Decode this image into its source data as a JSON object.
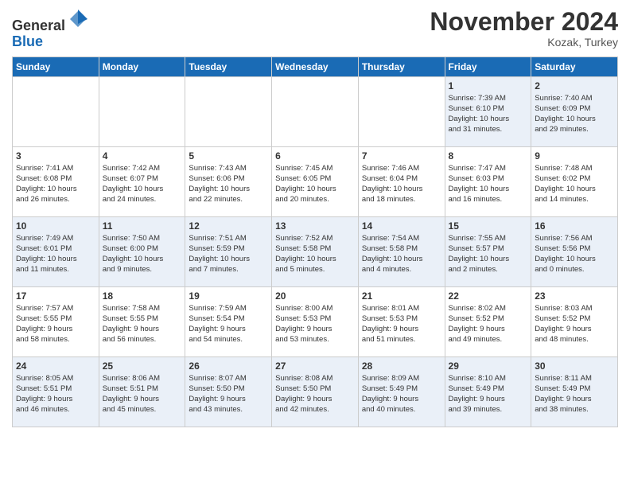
{
  "header": {
    "logo_line1": "General",
    "logo_line2": "Blue",
    "month": "November 2024",
    "location": "Kozak, Turkey"
  },
  "weekdays": [
    "Sunday",
    "Monday",
    "Tuesday",
    "Wednesday",
    "Thursday",
    "Friday",
    "Saturday"
  ],
  "weeks": [
    [
      {
        "day": "",
        "info": ""
      },
      {
        "day": "",
        "info": ""
      },
      {
        "day": "",
        "info": ""
      },
      {
        "day": "",
        "info": ""
      },
      {
        "day": "",
        "info": ""
      },
      {
        "day": "1",
        "info": "Sunrise: 7:39 AM\nSunset: 6:10 PM\nDaylight: 10 hours\nand 31 minutes."
      },
      {
        "day": "2",
        "info": "Sunrise: 7:40 AM\nSunset: 6:09 PM\nDaylight: 10 hours\nand 29 minutes."
      }
    ],
    [
      {
        "day": "3",
        "info": "Sunrise: 7:41 AM\nSunset: 6:08 PM\nDaylight: 10 hours\nand 26 minutes."
      },
      {
        "day": "4",
        "info": "Sunrise: 7:42 AM\nSunset: 6:07 PM\nDaylight: 10 hours\nand 24 minutes."
      },
      {
        "day": "5",
        "info": "Sunrise: 7:43 AM\nSunset: 6:06 PM\nDaylight: 10 hours\nand 22 minutes."
      },
      {
        "day": "6",
        "info": "Sunrise: 7:45 AM\nSunset: 6:05 PM\nDaylight: 10 hours\nand 20 minutes."
      },
      {
        "day": "7",
        "info": "Sunrise: 7:46 AM\nSunset: 6:04 PM\nDaylight: 10 hours\nand 18 minutes."
      },
      {
        "day": "8",
        "info": "Sunrise: 7:47 AM\nSunset: 6:03 PM\nDaylight: 10 hours\nand 16 minutes."
      },
      {
        "day": "9",
        "info": "Sunrise: 7:48 AM\nSunset: 6:02 PM\nDaylight: 10 hours\nand 14 minutes."
      }
    ],
    [
      {
        "day": "10",
        "info": "Sunrise: 7:49 AM\nSunset: 6:01 PM\nDaylight: 10 hours\nand 11 minutes."
      },
      {
        "day": "11",
        "info": "Sunrise: 7:50 AM\nSunset: 6:00 PM\nDaylight: 10 hours\nand 9 minutes."
      },
      {
        "day": "12",
        "info": "Sunrise: 7:51 AM\nSunset: 5:59 PM\nDaylight: 10 hours\nand 7 minutes."
      },
      {
        "day": "13",
        "info": "Sunrise: 7:52 AM\nSunset: 5:58 PM\nDaylight: 10 hours\nand 5 minutes."
      },
      {
        "day": "14",
        "info": "Sunrise: 7:54 AM\nSunset: 5:58 PM\nDaylight: 10 hours\nand 4 minutes."
      },
      {
        "day": "15",
        "info": "Sunrise: 7:55 AM\nSunset: 5:57 PM\nDaylight: 10 hours\nand 2 minutes."
      },
      {
        "day": "16",
        "info": "Sunrise: 7:56 AM\nSunset: 5:56 PM\nDaylight: 10 hours\nand 0 minutes."
      }
    ],
    [
      {
        "day": "17",
        "info": "Sunrise: 7:57 AM\nSunset: 5:55 PM\nDaylight: 9 hours\nand 58 minutes."
      },
      {
        "day": "18",
        "info": "Sunrise: 7:58 AM\nSunset: 5:55 PM\nDaylight: 9 hours\nand 56 minutes."
      },
      {
        "day": "19",
        "info": "Sunrise: 7:59 AM\nSunset: 5:54 PM\nDaylight: 9 hours\nand 54 minutes."
      },
      {
        "day": "20",
        "info": "Sunrise: 8:00 AM\nSunset: 5:53 PM\nDaylight: 9 hours\nand 53 minutes."
      },
      {
        "day": "21",
        "info": "Sunrise: 8:01 AM\nSunset: 5:53 PM\nDaylight: 9 hours\nand 51 minutes."
      },
      {
        "day": "22",
        "info": "Sunrise: 8:02 AM\nSunset: 5:52 PM\nDaylight: 9 hours\nand 49 minutes."
      },
      {
        "day": "23",
        "info": "Sunrise: 8:03 AM\nSunset: 5:52 PM\nDaylight: 9 hours\nand 48 minutes."
      }
    ],
    [
      {
        "day": "24",
        "info": "Sunrise: 8:05 AM\nSunset: 5:51 PM\nDaylight: 9 hours\nand 46 minutes."
      },
      {
        "day": "25",
        "info": "Sunrise: 8:06 AM\nSunset: 5:51 PM\nDaylight: 9 hours\nand 45 minutes."
      },
      {
        "day": "26",
        "info": "Sunrise: 8:07 AM\nSunset: 5:50 PM\nDaylight: 9 hours\nand 43 minutes."
      },
      {
        "day": "27",
        "info": "Sunrise: 8:08 AM\nSunset: 5:50 PM\nDaylight: 9 hours\nand 42 minutes."
      },
      {
        "day": "28",
        "info": "Sunrise: 8:09 AM\nSunset: 5:49 PM\nDaylight: 9 hours\nand 40 minutes."
      },
      {
        "day": "29",
        "info": "Sunrise: 8:10 AM\nSunset: 5:49 PM\nDaylight: 9 hours\nand 39 minutes."
      },
      {
        "day": "30",
        "info": "Sunrise: 8:11 AM\nSunset: 5:49 PM\nDaylight: 9 hours\nand 38 minutes."
      }
    ]
  ]
}
